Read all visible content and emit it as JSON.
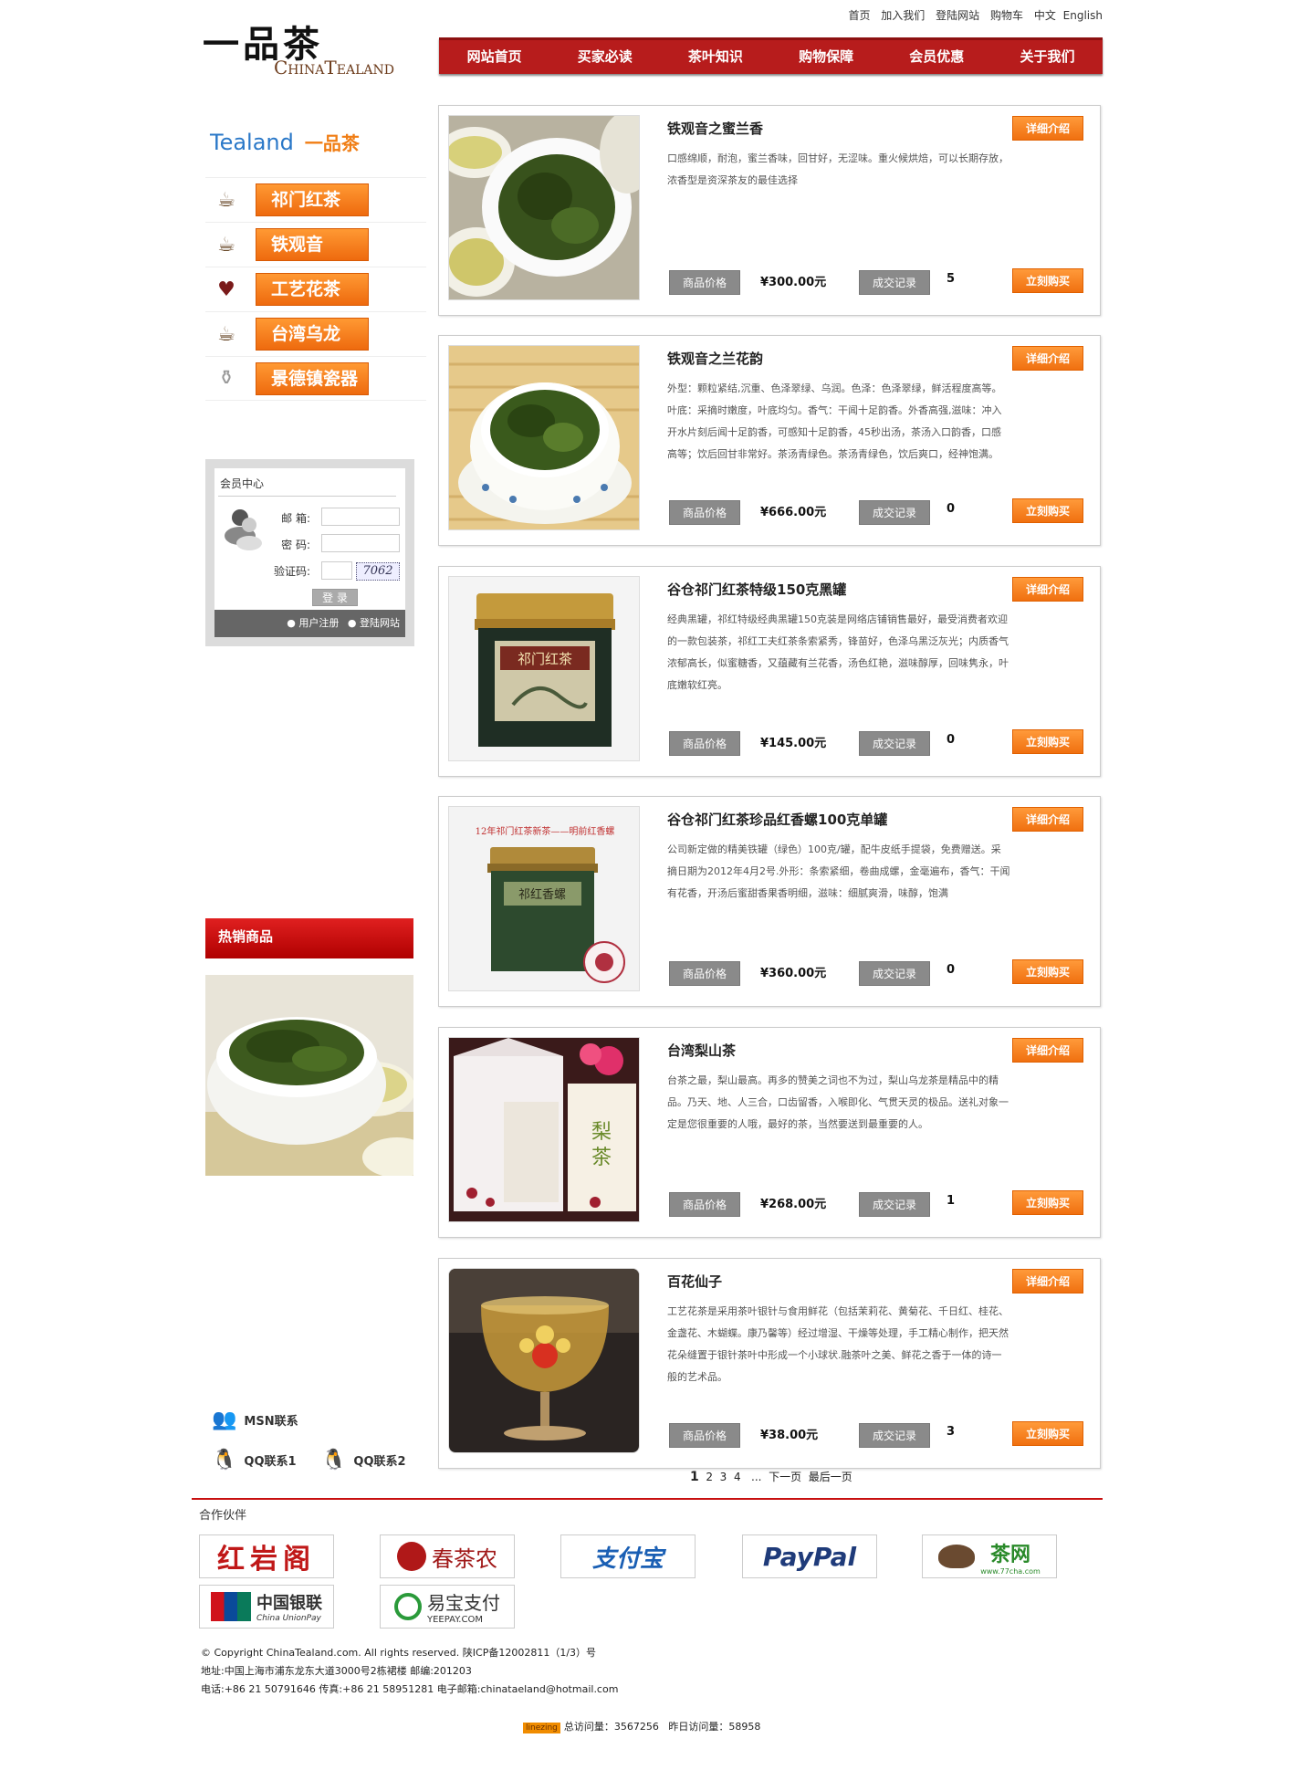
{
  "header": {
    "logo_cn": "一品茶",
    "logo_en": "ChinaTealand",
    "top_links": [
      "首页",
      "加入我们",
      "登陆网站",
      "购物车",
      "中文",
      "English"
    ],
    "nav": [
      "网站首页",
      "买家必读",
      "茶叶知识",
      "购物保障",
      "会员优惠",
      "关于我们"
    ]
  },
  "sidebar": {
    "brand_en": "Tealand",
    "brand_cn": "一品茶",
    "categories": [
      "祁门红茶",
      "铁观音",
      "工艺花茶",
      "台湾乌龙",
      "景德镇瓷器"
    ],
    "member": {
      "title": "会员中心",
      "email_label": "邮 箱:",
      "password_label": "密 码:",
      "captcha_label": "验证码:",
      "captcha_text": "7062",
      "login_button": "登 录",
      "register_link": "● 用户注册",
      "login_link": "● 登陆网站"
    },
    "hot_title": "热销商品",
    "contacts": {
      "msn": "MSN联系",
      "qq1": "QQ联系1",
      "qq2": "QQ联系2"
    }
  },
  "product_labels": {
    "detail": "详细介绍",
    "buy": "立刻购买",
    "price_label": "商品价格",
    "record_label": "成交记录"
  },
  "products": [
    {
      "title": "铁观音之蜜兰香",
      "desc": "口感绵顺，耐泡，蜜兰香味，回甘好，无涩味。重火候烘焙，可以长期存放，浓香型是资深茶友的最佳选择",
      "price": "¥300.00元",
      "sales": "5"
    },
    {
      "title": "铁观音之兰花韵",
      "desc": "外型：颗粒紧结,沉重、色泽翠绿、乌润。色泽：色泽翠绿，鲜活程度高等。叶底：采摘时嫩度，叶底均匀。香气：干闻十足韵香。外香高强,滋味：冲入开水片刻后闻十足韵香，可感知十足韵香，45秒出汤，茶汤入口韵香，口感高等；饮后回甘非常好。茶汤青绿色。茶汤青绿色，饮后爽口，经神饱满。",
      "price": "¥666.00元",
      "sales": "0"
    },
    {
      "title": "谷仓祁门红茶特级150克黑罐",
      "desc": "经典黑罐，祁红特级经典黑罐150克装是网络店铺销售最好，最受消费者欢迎的一款包装茶，祁红工夫红茶条索紧秀，锋苗好，色泽乌黑泛灰光；内质香气浓郁高长，似蜜糖香，又蕴藏有兰花香，汤色红艳，滋味醇厚，回味隽永，叶底嫩软红亮。",
      "price": "¥145.00元",
      "sales": "0"
    },
    {
      "title": "谷仓祁门红茶珍品红香螺100克单罐",
      "desc": "公司新定做的精美铁罐（绿色）100克/罐，配牛皮纸手提袋，免费赠送。采摘日期为2012年4月2号.外形：条索紧细，卷曲成螺，金毫遍布，香气：干闻有花香，开汤后蜜甜香果香明细，滋味：细腻爽滑，味醇，饱满",
      "price": "¥360.00元",
      "sales": "0"
    },
    {
      "title": "台湾梨山茶",
      "desc": "台茶之最，梨山最高。再多的赞美之词也不为过，梨山乌龙茶是精品中的精品。乃天、地、人三合，口齿留香，入喉即化、气贯天灵的极品。送礼对象一定是您很重要的人哦，最好的茶，当然要送到最重要的人。",
      "price": "¥268.00元",
      "sales": "1"
    },
    {
      "title": "百花仙子",
      "desc": "工艺花茶是采用茶叶银针与食用鲜花（包括茉莉花、黄菊花、千日红、桂花、金盏花、木蝴蝶。康乃馨等）经过增湿、干燥等处理，手工精心制作，把天然花朵缝置于银针茶叶中形成一个小球状.融茶叶之美、鲜花之香于一体的诗一般的艺术品。",
      "price": "¥38.00元",
      "sales": "3"
    }
  ],
  "product_images": {
    "p4_banner": "12年祁门红茶新茶——明前红香螺",
    "p3_can_label": "祁门红茶",
    "p4_can_label": "祁红香螺"
  },
  "pager": {
    "current": "1",
    "pages": [
      "2",
      "3",
      "4"
    ],
    "more": "...",
    "next": "下一页",
    "last": "最后一页"
  },
  "footer": {
    "partners_title": "合作伙伴",
    "partners": [
      "红岩阁",
      "春茶农",
      "支付宝",
      "PayPal",
      "茶网",
      "中国银联",
      "易宝支付"
    ],
    "partner_sub": {
      "unionpay": "China UnionPay",
      "yeepay": "YEEPAY.COM",
      "cha": "www.77cha.com"
    },
    "copyright": "© Copyright ChinaTealand.com. All rights reserved. 陕ICP备12002811（1/3）号",
    "address": "地址:中国上海市浦东龙东大道3000号2栋裙楼 邮编:201203",
    "contact": "电话:+86 21 50791646 传真:+86 21 58951281 电子邮箱:chinataeland@hotmail.com",
    "counter_badge": "linezing",
    "counter_total_label": "总访问量：",
    "counter_total": "3567256",
    "counter_yesterday_label": "昨日访问量：",
    "counter_yesterday": "58958"
  }
}
